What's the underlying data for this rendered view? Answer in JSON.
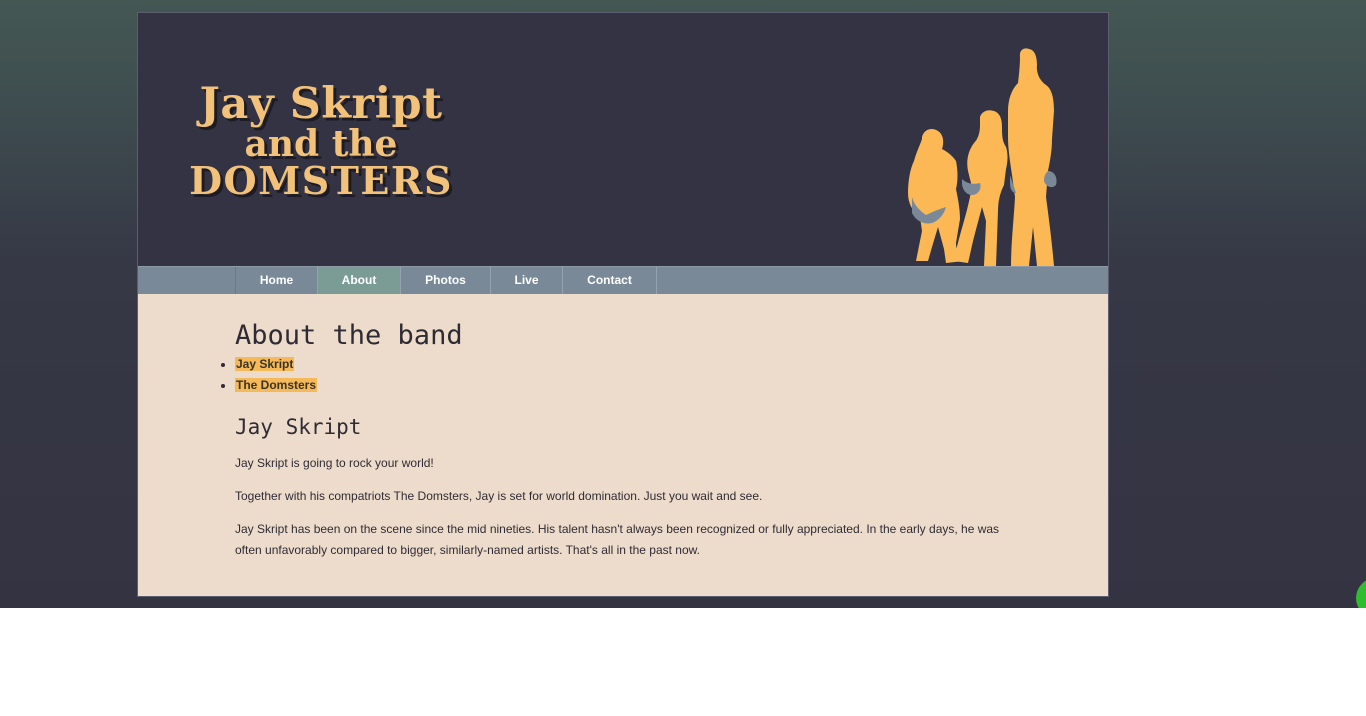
{
  "site": {
    "logo": {
      "line1": "Jay Skript",
      "line2": "and the",
      "line3": "DOMSTERS"
    }
  },
  "nav": {
    "items": [
      {
        "label": "Home"
      },
      {
        "label": "About"
      },
      {
        "label": "Photos"
      },
      {
        "label": "Live"
      },
      {
        "label": "Contact"
      }
    ],
    "active": "About"
  },
  "content": {
    "page_title": "About the band",
    "toc": [
      {
        "label": "Jay Skript"
      },
      {
        "label": "The Domsters"
      }
    ],
    "section_title": "Jay Skript",
    "paragraphs": [
      "Jay Skript is going to rock your world!",
      "Together with his compatriots The Domsters, Jay is set for world domination. Just you wait and see.",
      "Jay Skript has been on the scene since the mid nineties. His talent hasn't always been recognized or fully appreciated. In the early days, he was often unfavorably compared to bigger, similarly-named artists. That's all in the past now."
    ]
  },
  "colors": {
    "header_bg": "#343343",
    "nav_bg": "#7a8998",
    "nav_active_bg": "#7b9b95",
    "content_bg": "#eddccb",
    "logo_color": "#f2c27a",
    "highlight": "#f5b95a"
  },
  "icons": {
    "header_image": "band-silhouette"
  }
}
